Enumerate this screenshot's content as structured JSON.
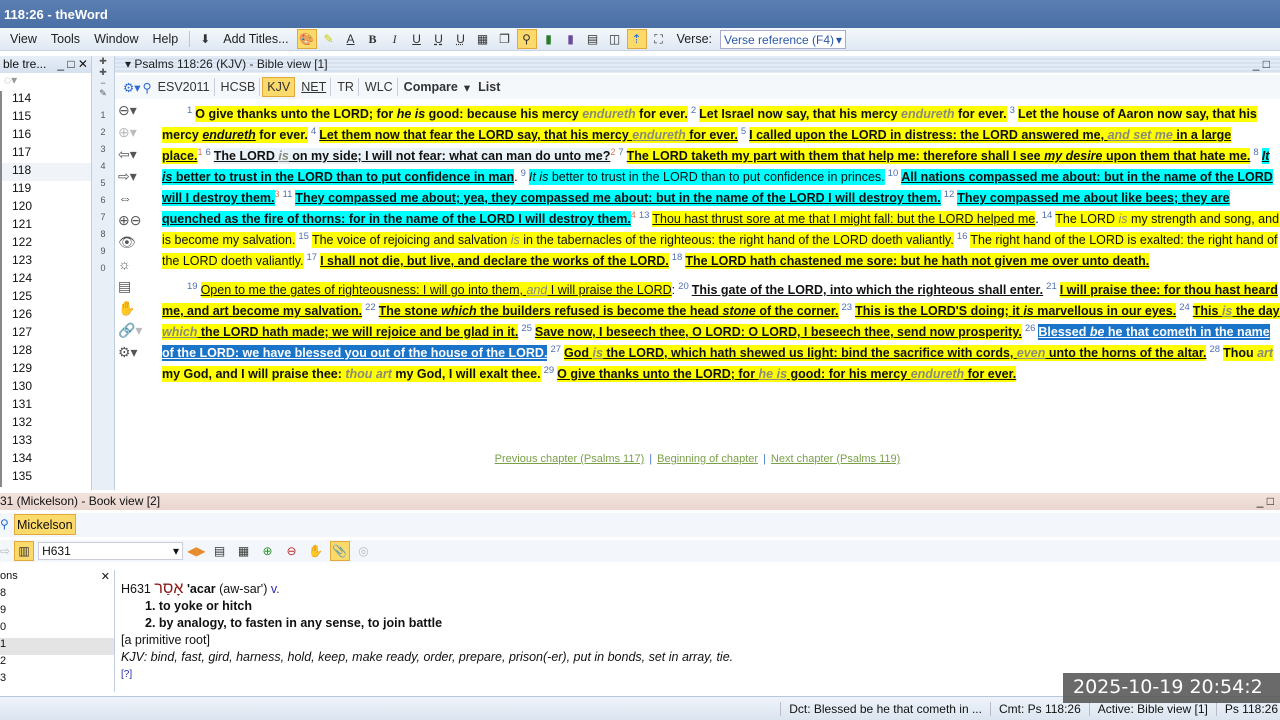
{
  "window": {
    "title": "118:26 - theWord"
  },
  "menu": [
    "View",
    "Tools",
    "Window",
    "Help"
  ],
  "toolbar": {
    "add_titles": "Add Titles...",
    "verse_label": "Verse:",
    "verse_value": "Verse reference (F4)"
  },
  "left_panel": {
    "title": "ble tre...",
    "items": [
      "114",
      "115",
      "116",
      "117",
      "118",
      "119",
      "120",
      "121",
      "122",
      "123",
      "124",
      "125",
      "126",
      "127",
      "128",
      "129",
      "130",
      "131",
      "132",
      "133",
      "134",
      "135"
    ]
  },
  "strip_numbers": [
    "1",
    "2",
    "3",
    "4",
    "5",
    "6",
    "7",
    "8",
    "9",
    "0"
  ],
  "bible": {
    "header": "Psalms 118:26 (KJV)  - Bible view [1]",
    "translations": [
      "ESV2011",
      "HCSB",
      "KJV",
      "NET",
      "TR",
      "WLC"
    ],
    "active_translation": "KJV",
    "compare": "Compare",
    "list": "List",
    "segments": [
      {
        "n": "1"
      },
      {
        "t": "O give thanks unto the LORD; for ",
        "s": "b y"
      },
      {
        "t": "he is",
        "s": "b y i"
      },
      {
        "t": " good: because his mercy ",
        "s": "b y"
      },
      {
        "t": "endureth",
        "s": "b y g"
      },
      {
        "t": " for ever.",
        "s": "b y"
      },
      {
        "n": "2"
      },
      {
        "t": "Let Israel now say, that his mercy ",
        "s": "b y"
      },
      {
        "t": "endureth",
        "s": "b y g"
      },
      {
        "t": " for ever.",
        "s": "b y"
      },
      {
        "n": "3"
      },
      {
        "t": "Let the house of Aaron now say, that his mercy ",
        "s": "b y"
      },
      {
        "t": "endureth",
        "s": "b y i u"
      },
      {
        "t": " for ever.",
        "s": "b y"
      },
      {
        "n": "4"
      },
      {
        "t": "Let them now that fear the LORD say, that his mercy ",
        "s": "b y u"
      },
      {
        "t": "endureth",
        "s": "b y u g"
      },
      {
        "t": " for ever.",
        "s": "b y u"
      },
      {
        "n": "5"
      },
      {
        "t": "I called upon the LORD in distress: the LORD answered me, ",
        "s": "b y u"
      },
      {
        "t": "and set me",
        "s": "b y u g"
      },
      {
        "t": " in a large place.",
        "s": "b y u"
      },
      {
        "f": "1"
      },
      {
        "n": "6"
      },
      {
        "t": "The LORD ",
        "s": "b l u"
      },
      {
        "t": "is",
        "s": "b l u g"
      },
      {
        "t": " on my side; I will not fear: what can man do unto me?",
        "s": "b l u"
      },
      {
        "f": "2"
      },
      {
        "n": "7"
      },
      {
        "t": "The LORD taketh my part with them that help me: therefore shall I see ",
        "s": "b y u"
      },
      {
        "t": "my desire",
        "s": "b y u i"
      },
      {
        "t": " upon them that hate me.",
        "s": "b y u"
      },
      {
        "n": "8"
      },
      {
        "t": "It is",
        "s": "b c u i"
      },
      {
        "t": " better to trust in the LORD than to put confidence in man",
        "s": "b c u"
      },
      {
        "t": ".",
        "s": ""
      },
      {
        "n": "9"
      },
      {
        "t": "It is",
        "s": "c i"
      },
      {
        "t": " better to trust in the LORD than to put confidence in princes.",
        "s": "c"
      },
      {
        "n": "10"
      },
      {
        "t": "All nations compassed me about: but in the name of the LORD will I destroy them.",
        "s": "b c u"
      },
      {
        "f": "3"
      },
      {
        "n": "11"
      },
      {
        "t": "They compassed me about; yea, they compassed me about: but in the name of the LORD I will destroy them.",
        "s": "b c u"
      },
      {
        "n": "12"
      },
      {
        "t": "They compassed me about like bees; they are quenched as the fire of thorns: for in the name of the LORD I will destroy them.",
        "s": "b c u"
      },
      {
        "f": "4"
      },
      {
        "n": "13"
      },
      {
        "t": "Thou hast thrust sore at me that I might fall: but the LORD helped me",
        "s": "y u"
      },
      {
        "t": ".",
        "s": ""
      },
      {
        "n": "14"
      },
      {
        "t": "The LORD ",
        "s": "y"
      },
      {
        "t": "is",
        "s": "y g"
      },
      {
        "t": " my strength and song, and is become my salvation.",
        "s": "y"
      },
      {
        "n": "15"
      },
      {
        "t": "The voice of rejoicing and salvation ",
        "s": "y"
      },
      {
        "t": "is",
        "s": "y g"
      },
      {
        "t": " in the tabernacles of the righteous: the right hand of the LORD doeth valiantly.",
        "s": "y"
      },
      {
        "n": "16"
      },
      {
        "t": "The right hand of the LORD is exalted: the right hand of the LORD doeth valiantly.",
        "s": "y"
      },
      {
        "n": "17"
      },
      {
        "t": "I shall not die, but live, and declare the works of the LORD.",
        "s": "b y u"
      },
      {
        "n": "18"
      },
      {
        "t": "The LORD hath chastened me sore: but he hath not given me over unto death.",
        "s": "b y u"
      },
      {
        "p": true
      },
      {
        "n": "19"
      },
      {
        "t": "Open to me the gates of righteousness: I will go into them, ",
        "s": "y u"
      },
      {
        "t": "and",
        "s": "y u g"
      },
      {
        "t": " I will praise the LORD",
        "s": "y u"
      },
      {
        "t": ":",
        "s": ""
      },
      {
        "n": "20"
      },
      {
        "t": "This gate of the LORD, into which the righteous shall enter.",
        "s": "b u"
      },
      {
        "n": "21"
      },
      {
        "t": "I will praise thee: for thou hast heard me, and art become my salvation.",
        "s": "b y u"
      },
      {
        "n": "22"
      },
      {
        "t": "The stone ",
        "s": "b y u"
      },
      {
        "t": "which",
        "s": "b y u i"
      },
      {
        "t": " the builders refused is become the head ",
        "s": "b y u"
      },
      {
        "t": "stone",
        "s": "b y u i"
      },
      {
        "t": " of the corner.",
        "s": "b y u"
      },
      {
        "n": "23"
      },
      {
        "t": "This is the LORD'S doing; it ",
        "s": "b y u"
      },
      {
        "t": "is",
        "s": "b y u i"
      },
      {
        "t": " marvellous in our eyes.",
        "s": "b y u"
      },
      {
        "n": "24"
      },
      {
        "t": "This ",
        "s": "b y u"
      },
      {
        "t": "is",
        "s": "b y u g"
      },
      {
        "t": " the day ",
        "s": "b y u"
      },
      {
        "t": "which",
        "s": "b y u g"
      },
      {
        "t": " the LORD hath made; we will rejoice and be glad in it.",
        "s": "b y u"
      },
      {
        "n": "25"
      },
      {
        "t": "Save now, I beseech thee, O LORD: O LORD, I beseech thee, send now prosperity.",
        "s": "b y u"
      },
      {
        "n": "26"
      },
      {
        "t": "Blessed ",
        "s": "b s u"
      },
      {
        "t": "be",
        "s": "b s u i"
      },
      {
        "t": " he that cometh in the name of the LORD: we have blessed you out of the house of the LORD.",
        "s": "b s u"
      },
      {
        "n": "27"
      },
      {
        "t": "God ",
        "s": "b y u"
      },
      {
        "t": "is",
        "s": "b y u g"
      },
      {
        "t": " the LORD, which hath shewed us light: bind the sacrifice with cords, ",
        "s": "b y u"
      },
      {
        "t": "even",
        "s": "b y u g"
      },
      {
        "t": " unto the horns of the altar.",
        "s": "b y u"
      },
      {
        "n": "28"
      },
      {
        "t": "Thou ",
        "s": "b y"
      },
      {
        "t": "art",
        "s": "b y g"
      },
      {
        "t": " my God, and I will praise thee: ",
        "s": "b y"
      },
      {
        "t": "thou art",
        "s": "b y g"
      },
      {
        "t": " my God, I will exalt thee.",
        "s": "b y"
      },
      {
        "n": "29"
      },
      {
        "t": "O give thanks unto the LORD; for ",
        "s": "b y u"
      },
      {
        "t": "he is",
        "s": "b y u g"
      },
      {
        "t": " good: for his mercy ",
        "s": "b y u"
      },
      {
        "t": "endureth",
        "s": "b y u g"
      },
      {
        "t": " for ever.",
        "s": "b y u"
      }
    ],
    "nav": {
      "prev": "Previous chapter (Psalms 117)",
      "begin": "Beginning of chapter",
      "next": "Next chapter (Psalms 119)",
      "sep": "|"
    }
  },
  "book": {
    "header": "31 (Mickelson) - Book view [2]",
    "tab": "Mickelson",
    "topic": "H631",
    "list_title": "ons",
    "list_items": [
      "8",
      "9",
      "0",
      "1",
      "2",
      "3"
    ],
    "entry": {
      "id": "H631",
      "hebrew": "אָסַר",
      "word": "'acar",
      "pron": "(aw-sar')",
      "pos": "v.",
      "def1": "1. to yoke or hitch",
      "def2": "2. by analogy, to fasten in any sense, to join battle",
      "root": "[a primitive root]",
      "kjv": "KJV: bind, fast, gird, harness, hold, keep, make ready, order, prepare, prison(-er), put in bonds, set in array, tie.",
      "help": "[?]"
    }
  },
  "status": {
    "dct": "Dct:  Blessed be he that cometh in ...",
    "cmt": "Cmt: Ps 118:26",
    "active": "Active: Bible view [1]",
    "ref": "Ps 118:26"
  },
  "timestamp": "2025-10-19 20:54:2"
}
